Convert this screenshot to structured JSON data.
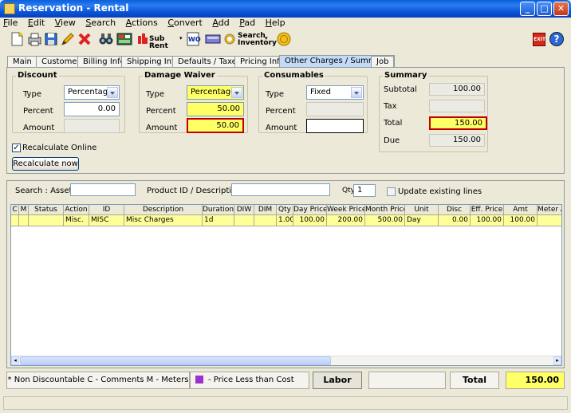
{
  "window": {
    "title": "Reservation - Rental",
    "buttons": [
      "_",
      "□",
      "✕"
    ]
  },
  "menu": [
    "File",
    "Edit",
    "View",
    "Search",
    "Actions",
    "Convert",
    "Add",
    "Pad",
    "Help"
  ],
  "toolbar": {
    "sub_rent_label": "Sub Rent",
    "wo_label": "WO",
    "search_inventory_label": "Search Inventory",
    "exit_label": "EXIT",
    "help_label": "?"
  },
  "tabs": [
    "Main",
    "Customer",
    "Billing Info",
    "Shipping Info",
    "Defaults / Taxes",
    "Pricing Info",
    "Other Charges / Summary",
    "Job"
  ],
  "active_tab": "Other Charges / Summary",
  "discount": {
    "legend": "Discount",
    "type_label": "Type",
    "type_value": "Percentage",
    "percent_label": "Percent",
    "percent_value": "0.00",
    "amount_label": "Amount",
    "amount_value": ""
  },
  "damage_waiver": {
    "legend": "Damage Waiver",
    "type_label": "Type",
    "type_value": "Percentage",
    "percent_label": "Percent",
    "percent_value": "50.00",
    "amount_label": "Amount",
    "amount_value": "50.00"
  },
  "consumables": {
    "legend": "Consumables",
    "type_label": "Type",
    "type_value": "Fixed",
    "percent_label": "Percent",
    "percent_value": "",
    "amount_label": "Amount",
    "amount_value": ""
  },
  "summary": {
    "legend": "Summary",
    "subtotal_label": "Subtotal",
    "subtotal_value": "100.00",
    "tax_label": "Tax",
    "tax_value": "",
    "total_label": "Total",
    "total_value": "150.00",
    "due_label": "Due",
    "due_value": "150.00"
  },
  "recalc_online_label": "Recalculate Online",
  "recalc_online_checked": true,
  "recalc_now_label": "Recalculate now",
  "search": {
    "asset_label": "Search :  Asset#",
    "product_label": "Product ID / Description",
    "qty_label": "Qty",
    "qty_value": "1",
    "update_label": "Update existing lines"
  },
  "grid": {
    "headers": [
      "C",
      "M",
      "Status",
      "Action",
      "ID",
      "Description",
      "Duration",
      "DIW",
      "DIM",
      "Qty",
      "Day Price",
      "Week Price",
      "Month Price",
      "Unit",
      "Disc",
      "Eff. Price",
      "Amt",
      "Meter A"
    ],
    "rows": [
      [
        "",
        "",
        "",
        "Misc.",
        "MISC",
        "Misc Charges",
        "1d",
        "",
        "",
        "1.00",
        "100.00",
        "200.00",
        "500.00",
        "Day",
        "0.00",
        "100.00",
        "100.00",
        ""
      ]
    ]
  },
  "status": {
    "legend_text": "* Non Discountable   C - Comments   M - Meters",
    "price_less_label": "- Price Less than Cost",
    "labor_label": "Labor",
    "total_label": "Total",
    "total_value": "150.00",
    "purple": "#9933cc",
    "yellow": "#ffff66"
  }
}
